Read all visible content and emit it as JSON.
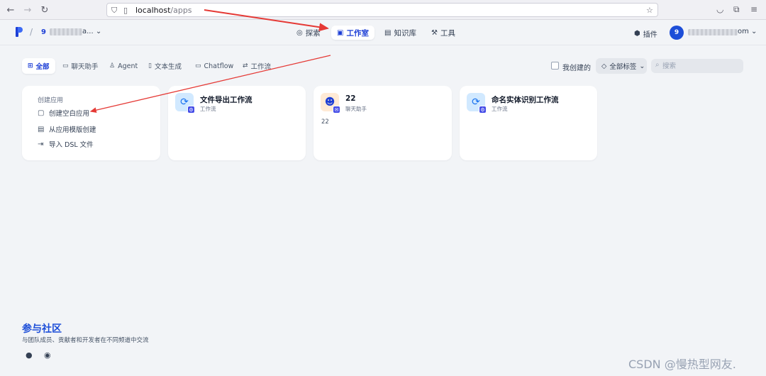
{
  "browser": {
    "url_host": "localhost",
    "url_path": "/apps"
  },
  "header": {
    "workspace_number": "9",
    "workspace_suffix": "a...",
    "nav": [
      {
        "label": "探索",
        "icon": "compass-icon"
      },
      {
        "label": "工作室",
        "icon": "robot-icon"
      },
      {
        "label": "知识库",
        "icon": "book-icon"
      },
      {
        "label": "工具",
        "icon": "hammer-icon"
      }
    ],
    "plugin_label": "插件",
    "avatar_initial": "9",
    "user_suffix": "om"
  },
  "tabs": [
    {
      "label": "全部"
    },
    {
      "label": "聊天助手"
    },
    {
      "label": "Agent"
    },
    {
      "label": "文本生成"
    },
    {
      "label": "Chatflow"
    },
    {
      "label": "工作流"
    }
  ],
  "filters": {
    "created_by_me_label": "我创建的",
    "tag_label": "全部标签",
    "search_placeholder": "搜索"
  },
  "create": {
    "title": "创建应用",
    "items": [
      {
        "label": "创建空白应用"
      },
      {
        "label": "从应用模版创建"
      },
      {
        "label": "导入 DSL 文件"
      }
    ]
  },
  "apps": [
    {
      "name": "文件导出工作流",
      "type": "工作流",
      "desc": ""
    },
    {
      "name": "22",
      "type": "聊天助手",
      "desc": "22"
    },
    {
      "name": "命名实体识别工作流",
      "type": "工作流",
      "desc": ""
    }
  ],
  "community": {
    "title": "参与社区",
    "subtitle": "与团队成员、贡献者和开发者在不同频道中交流"
  },
  "watermark": "CSDN @慢热型网友."
}
